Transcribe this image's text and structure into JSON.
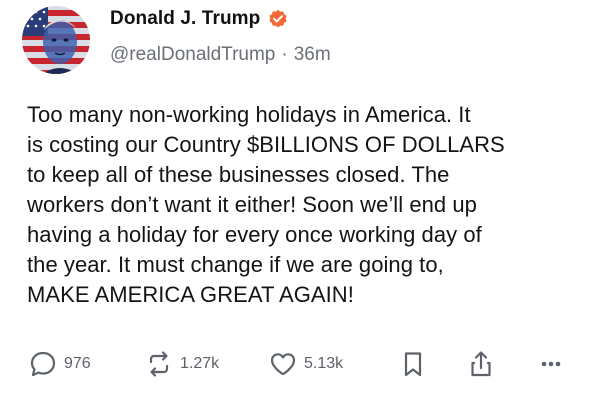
{
  "post": {
    "author": {
      "display_name": "Donald J. Trump",
      "handle": "@realDonaldTrump",
      "separator": "·",
      "time_ago": "36m",
      "verified_badge": "verified-check-icon",
      "avatar": "flag-portrait-avatar"
    },
    "text_lines": [
      "Too many non-working holidays in America. It",
      "is costing our Country $BILLIONS OF DOLLARS",
      "to keep all of these businesses closed. The",
      "workers don’t want it either! Soon we’ll end up",
      "having a holiday for every once working day of",
      "the year. It must change if we are going to,",
      "MAKE AMERICA GREAT AGAIN!"
    ],
    "actions": {
      "reply": {
        "icon": "comment-bubble-icon",
        "count": "976"
      },
      "retruth": {
        "icon": "repost-arrows-icon",
        "count": "1.27k"
      },
      "like": {
        "icon": "heart-icon",
        "count": "5.13k"
      },
      "bookmark": {
        "icon": "bookmark-icon"
      },
      "share": {
        "icon": "share-icon"
      },
      "more": {
        "icon": "more-dots-icon"
      }
    },
    "colors": {
      "verified": "#f06a35",
      "secondary_text": "#6b7078",
      "action_icon": "#5d626a"
    }
  }
}
